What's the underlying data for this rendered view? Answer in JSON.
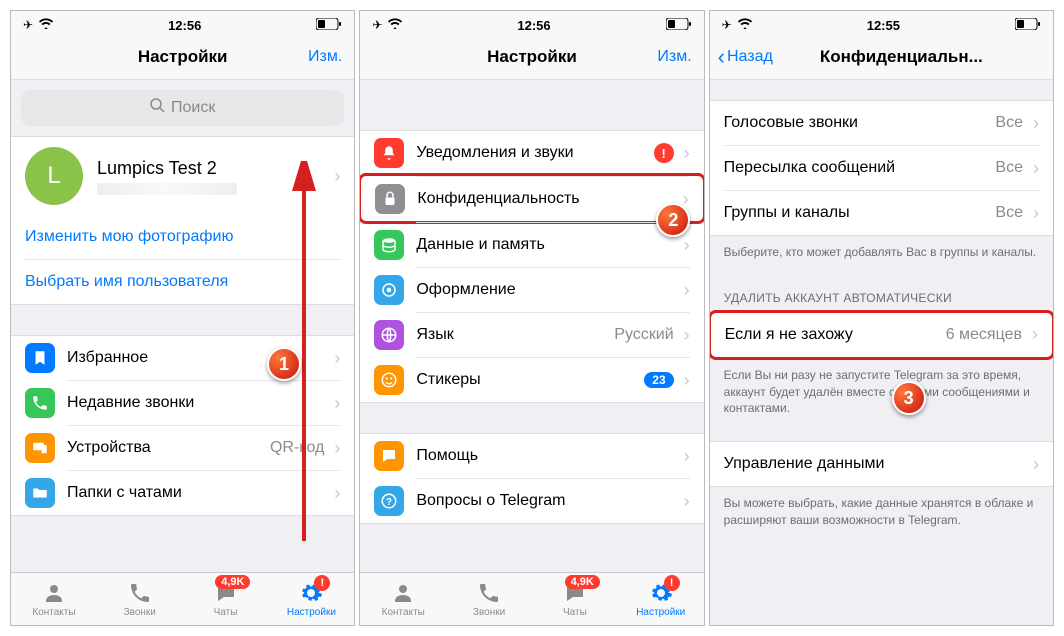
{
  "screens": [
    {
      "status": {
        "time": "12:56"
      },
      "nav": {
        "title": "Настройки",
        "edit": "Изм."
      },
      "search_placeholder": "Поиск",
      "profile": {
        "initial": "L",
        "name": "Lumpics Test 2"
      },
      "links": {
        "change_photo": "Изменить мою фотографию",
        "choose_username": "Выбрать имя пользователя"
      },
      "items": [
        {
          "label": "Избранное",
          "color": "#007aff"
        },
        {
          "label": "Недавние звонки",
          "color": "#35c759"
        },
        {
          "label": "Устройства",
          "value": "QR-код",
          "color": "#ff9500"
        },
        {
          "label": "Папки с чатами",
          "color": "#33a7e8"
        }
      ],
      "tabs": {
        "contacts": "Контакты",
        "calls": "Звонки",
        "chats": "Чаты",
        "settings": "Настройки",
        "badge": "4,9K"
      },
      "annotation": "1"
    },
    {
      "status": {
        "time": "12:56"
      },
      "nav": {
        "title": "Настройки",
        "edit": "Изм."
      },
      "items1": [
        {
          "label": "Уведомления и звуки",
          "color": "#ff3b30",
          "alert": true
        },
        {
          "label": "Конфиденциальность",
          "color": "#8e8e93",
          "highlight": true
        },
        {
          "label": "Данные и память",
          "color": "#35c759"
        },
        {
          "label": "Оформление",
          "color": "#33a7e8"
        },
        {
          "label": "Язык",
          "value": "Русский",
          "color": "#af52de"
        },
        {
          "label": "Стикеры",
          "badge": "23",
          "color": "#ff9500"
        }
      ],
      "items2": [
        {
          "label": "Помощь",
          "color": "#ff9500"
        },
        {
          "label": "Вопросы о Telegram",
          "color": "#33a7e8"
        }
      ],
      "tabs": {
        "contacts": "Контакты",
        "calls": "Звонки",
        "chats": "Чаты",
        "settings": "Настройки",
        "badge": "4,9K"
      },
      "annotation": "2"
    },
    {
      "status": {
        "time": "12:55"
      },
      "nav": {
        "back": "Назад",
        "title": "Конфиденциальн..."
      },
      "items1": [
        {
          "label": "Голосовые звонки",
          "value": "Все"
        },
        {
          "label": "Пересылка сообщений",
          "value": "Все"
        },
        {
          "label": "Группы и каналы",
          "value": "Все"
        }
      ],
      "footer1": "Выберите, кто может добавлять Вас в группы и каналы.",
      "header2": "Удалить аккаунт автоматически",
      "items2": [
        {
          "label": "Если я не захожу",
          "value": "6 месяцев",
          "highlight": true
        }
      ],
      "footer2": "Если Вы ни разу не запустите Telegram за это время, аккаунт будет удалён вместе со всеми сообщениями и контактами.",
      "items3": [
        {
          "label": "Управление данными"
        }
      ],
      "footer3": "Вы можете выбрать, какие данные хранятся в облаке и расширяют ваши возможности в Telegram.",
      "annotation": "3"
    }
  ]
}
